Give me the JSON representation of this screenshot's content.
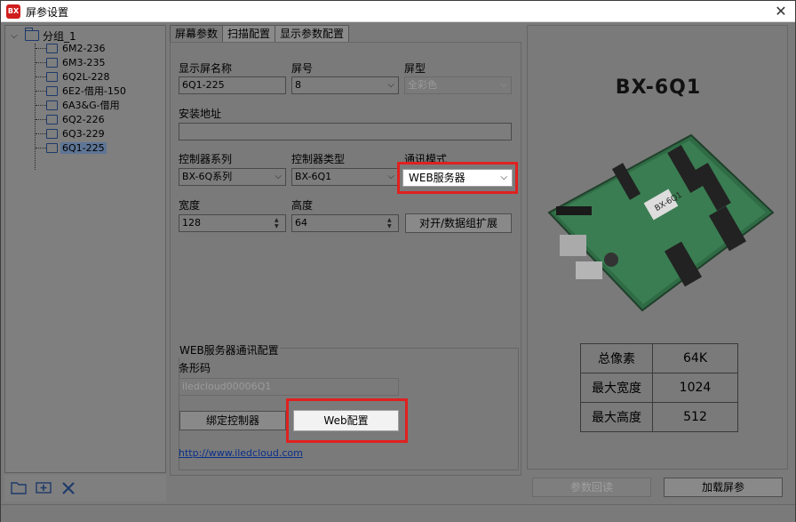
{
  "window": {
    "title": "屏参设置",
    "logo_text": "BX"
  },
  "tree": {
    "root": "分组_1",
    "items": [
      "6M2-236",
      "6M3-235",
      "6Q2L-228",
      "6E2-借用-150",
      "6A3&G-借用",
      "6Q2-226",
      "6Q3-229",
      "6Q1-225"
    ],
    "selected_index": 7
  },
  "tabs": [
    "屏幕参数",
    "扫描配置",
    "显示参数配置"
  ],
  "form": {
    "display_name_label": "显示屏名称",
    "display_name_value": "6Q1-225",
    "screen_no_label": "屏号",
    "screen_no_value": "8",
    "screen_type_label": "屏型",
    "screen_type_value": "全彩色",
    "install_addr_label": "安装地址",
    "install_addr_value": "",
    "ctrl_series_label": "控制器系列",
    "ctrl_series_value": "BX-6Q系列",
    "ctrl_type_label": "控制器类型",
    "ctrl_type_value": "BX-6Q1",
    "comm_mode_label": "通讯模式",
    "comm_mode_value": "WEB服务器",
    "width_label": "宽度",
    "width_value": "128",
    "height_label": "高度",
    "height_value": "64",
    "expand_button": "对开/数据组扩展"
  },
  "web_group": {
    "title": "WEB服务器通讯配置",
    "barcode_label": "条形码",
    "barcode_value": "iledcloud00006Q1",
    "bind_button": "绑定控制器",
    "web_config_button": "Web配置",
    "link": "http://www.iledcloud.com"
  },
  "right": {
    "model": "BX-6Q1",
    "specs": [
      {
        "key": "总像素",
        "value": "64K"
      },
      {
        "key": "最大宽度",
        "value": "1024"
      },
      {
        "key": "最大高度",
        "value": "512"
      }
    ]
  },
  "footer": {
    "readback_button": "参数回读",
    "load_button": "加载屏参"
  }
}
